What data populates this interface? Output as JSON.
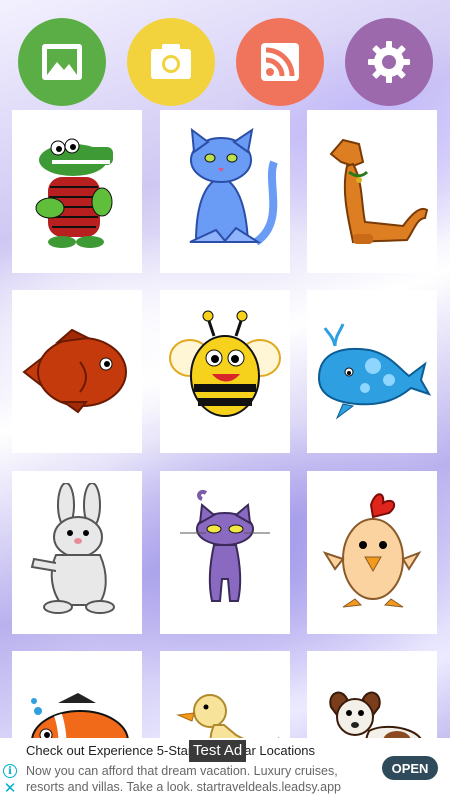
{
  "toolbar": {
    "buttons": [
      {
        "name": "gallery",
        "icon": "image-icon",
        "color": "#5bae45"
      },
      {
        "name": "camera",
        "icon": "camera-icon",
        "color": "#f2d33e"
      },
      {
        "name": "feed",
        "icon": "rss-icon",
        "color": "#f0745c"
      },
      {
        "name": "settings",
        "icon": "gear-icon",
        "color": "#9c69ad"
      }
    ]
  },
  "grid": {
    "items": [
      {
        "name": "crocodile"
      },
      {
        "name": "blue-cat"
      },
      {
        "name": "orange-dog"
      },
      {
        "name": "red-fish"
      },
      {
        "name": "bee"
      },
      {
        "name": "blue-whale"
      },
      {
        "name": "bunny"
      },
      {
        "name": "purple-cat"
      },
      {
        "name": "chick"
      },
      {
        "name": "clownfish"
      },
      {
        "name": "duck"
      },
      {
        "name": "spotted-dog"
      }
    ]
  },
  "ad": {
    "title": "Check out Experience 5-Star Lux 5-Star Locations",
    "body": "Now you can afford that dream vacation. Luxury cruises, resorts and villas. Take a look. startraveldeals.leadsy.app",
    "tag": "Test Ad",
    "open_label": "OPEN",
    "info_glyph": "i",
    "close_glyph": "✕"
  }
}
